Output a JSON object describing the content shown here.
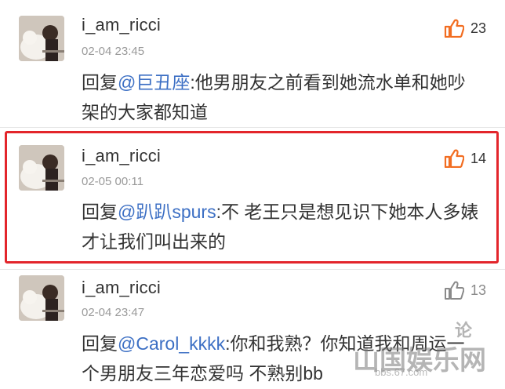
{
  "comments": [
    {
      "username": "i_am_ricci",
      "time": "02-04 23:45",
      "reply_prefix": "回复",
      "mention": "@巨丑座",
      "text": ":他男朋友之前看到她流水单和她吵架的大家都知道",
      "likes": "23",
      "liked": true
    },
    {
      "username": "i_am_ricci",
      "time": "02-05 00:11",
      "reply_prefix": "回复",
      "mention": "@趴趴spurs",
      "text": ":不 老王只是想见识下她本人多婊才让我们叫出来的",
      "likes": "14",
      "liked": true
    },
    {
      "username": "i_am_ricci",
      "time": "02-04 23:47",
      "reply_prefix": "回复",
      "mention": "@Carol_kkkk",
      "text": ":你和我熟？你知道我和周运一个男朋友三年恋爱吗 不熟别bb",
      "likes": "13",
      "liked": false
    }
  ],
  "colors": {
    "accent_like": "#f26d21",
    "mention": "#3c6fc4",
    "highlight": "#e3252b"
  },
  "icons": {
    "like": "thumbs-up-icon"
  },
  "watermark": {
    "text": "论",
    "text2": "山国娱乐网",
    "domain": "bbs.67.com"
  }
}
